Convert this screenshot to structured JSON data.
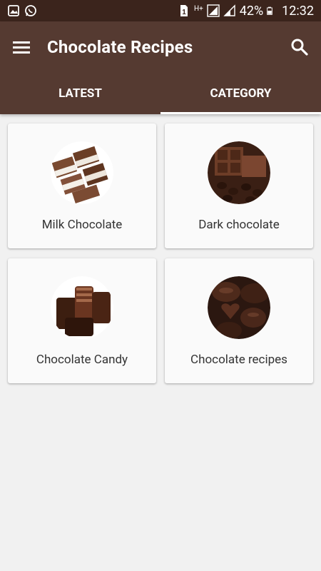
{
  "status_bar": {
    "battery": "42%",
    "time": "12:32",
    "network": "H+",
    "sim": "1"
  },
  "toolbar": {
    "title": "Chocolate Recipes"
  },
  "tabs": [
    {
      "label": "LATEST",
      "active": false
    },
    {
      "label": "CATEGORY",
      "active": true
    }
  ],
  "categories": [
    {
      "label": "Milk Chocolate"
    },
    {
      "label": "Dark chocolate"
    },
    {
      "label": "Chocolate Candy"
    },
    {
      "label": "Chocolate recipes"
    }
  ],
  "colors": {
    "status_bar": "#3b241c",
    "app_bar": "#553a31",
    "background": "#f1f1f1",
    "card": "#fafafa"
  }
}
